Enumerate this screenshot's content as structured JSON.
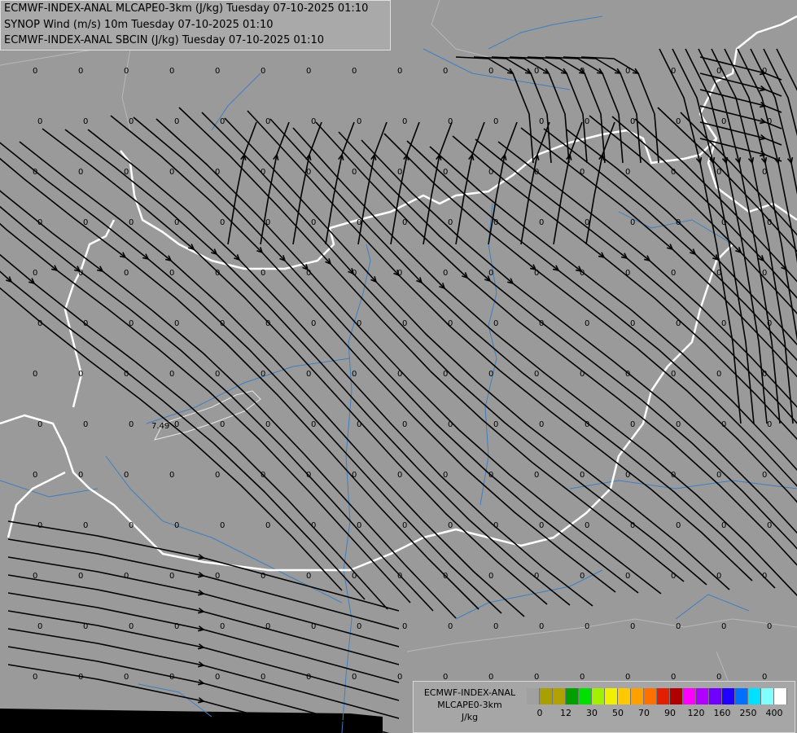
{
  "header": {
    "line1": "ECMWF-INDEX-ANAL MLCAPE0-3km (J/kg) Tuesday 07-10-2025 01:10",
    "line2": "SYNOP Wind (m/s) 10m Tuesday 07-10-2025 01:10",
    "line3": "ECMWF-INDEX-ANAL SBCIN (J/kg) Tuesday 07-10-2025 01:10"
  },
  "map": {
    "station_value": "0",
    "contour_label": "7.49",
    "background_color": "#9a9a9a",
    "border_color": "#ffffff",
    "river_color": "#3f7fbf"
  },
  "legend": {
    "title_line1": "ECMWF-INDEX-ANAL",
    "title_line2": "MLCAPE0-3km",
    "unit": "J/kg",
    "colors": [
      "#a0a0a0",
      "#a8a000",
      "#b0a000",
      "#00a000",
      "#00e000",
      "#a0f000",
      "#f0f000",
      "#ffc800",
      "#ffa000",
      "#ff7000",
      "#e02000",
      "#b00000",
      "#ff00ff",
      "#b000ff",
      "#7000ff",
      "#2000ff",
      "#0070ff",
      "#00e0ff",
      "#80ffff",
      "#ffffff"
    ],
    "ticks": [
      "0",
      "12",
      "30",
      "50",
      "70",
      "90",
      "120",
      "160",
      "250",
      "400"
    ]
  }
}
